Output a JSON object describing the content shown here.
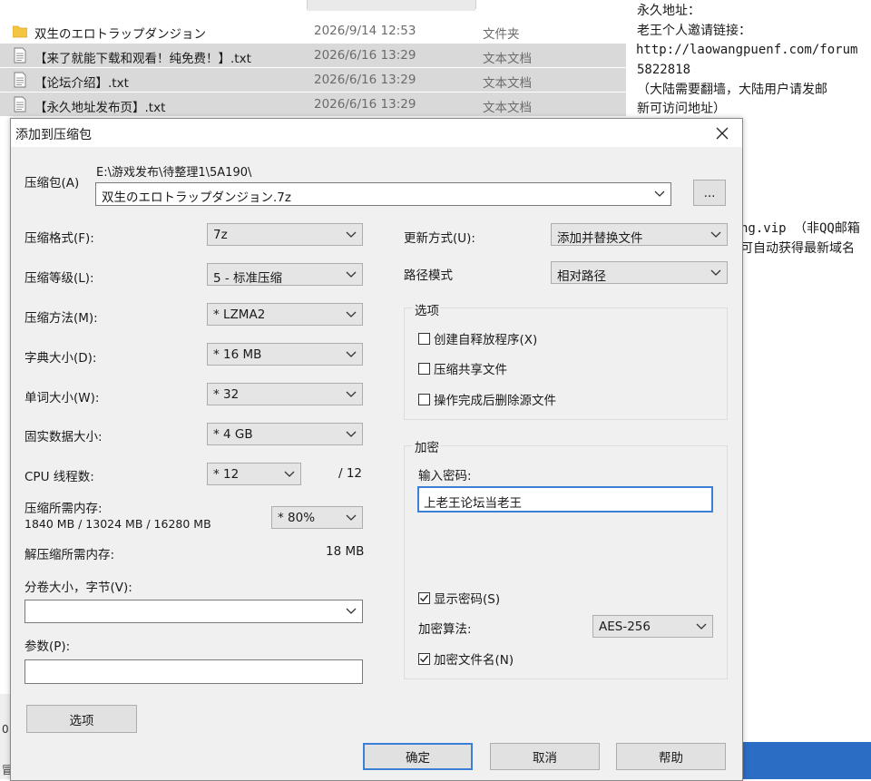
{
  "explorer": {
    "files": [
      {
        "name": "双生のエロトラップダンジョン",
        "date": "2026/9/14 12:53",
        "type": "文件夹",
        "icon": "folder-icon",
        "selected": false
      },
      {
        "name": "【来了就能下载和观看！纯免费！】.txt",
        "date": "2026/6/16 13:29",
        "type": "文本文档",
        "icon": "text-file-icon",
        "selected": true
      },
      {
        "name": "【论坛介绍】.txt",
        "date": "2026/6/16 13:29",
        "type": "文本文档",
        "icon": "text-file-icon",
        "selected": true
      },
      {
        "name": "【永久地址发布页】.txt",
        "date": "2026/6/16 13:29",
        "type": "文本文档",
        "icon": "text-file-icon",
        "selected": true
      }
    ]
  },
  "notepad": {
    "lines": [
      "永久地址：",
      "老王个人邀请链接：",
      "http://laowangpuenf.com/forum",
      "5822818",
      "（大陆需要翻墙，大陆用户请发邮",
      "新可访问地址）",
      "ng.vip （非QQ邮箱",
      "可自动获得最新域名"
    ]
  },
  "left_fragment": [
    "0",
    "",
    "冒"
  ],
  "dialog": {
    "title": "添加到压缩包",
    "archive_label": "压缩包(A)",
    "archive_path": "E:\\游戏发布\\待整理1\\5A190\\",
    "archive_name": "双生のエロトラップダンジョン.7z",
    "browse_label": "...",
    "format_label": "压缩格式(F):",
    "format_value": "7z",
    "level_label": "压缩等级(L):",
    "level_value": "5 - 标准压缩",
    "method_label": "压缩方法(M):",
    "method_value": "* LZMA2",
    "dict_label": "字典大小(D):",
    "dict_value": "* 16 MB",
    "word_label": "单词大小(W):",
    "word_value": "* 32",
    "solid_label": "固实数据大小:",
    "solid_value": "* 4 GB",
    "cpu_label": "CPU 线程数:",
    "cpu_value": "* 12",
    "cpu_total": "/ 12",
    "mem_label": "压缩所需内存:",
    "mem_detail": "1840 MB / 13024 MB / 16280 MB",
    "mem_percent": "* 80%",
    "decomp_label": "解压缩所需内存:",
    "decomp_value": "18 MB",
    "split_label": "分卷大小，字节(V):",
    "split_value": "",
    "params_label": "参数(P):",
    "params_value": "",
    "options_button": "选项",
    "update_label": "更新方式(U):",
    "update_value": "添加并替换文件",
    "path_label": "路径模式",
    "path_value": "相对路径",
    "options_group": "选项",
    "opt_sfx": "创建自释放程序(X)",
    "opt_sfx_checked": false,
    "opt_shared": "压缩共享文件",
    "opt_shared_checked": false,
    "opt_delete": "操作完成后删除源文件",
    "opt_delete_checked": false,
    "encrypt_group": "加密",
    "password_label": "输入密码:",
    "password_value": "上老王论坛当老王",
    "show_password": "显示密码(S)",
    "show_password_checked": true,
    "enc_method_label": "加密算法:",
    "enc_method_value": "AES-256",
    "encrypt_names": "加密文件名(N)",
    "encrypt_names_checked": true,
    "ok_button": "确定",
    "cancel_button": "取消",
    "help_button": "帮助"
  },
  "colors": {
    "dialog_bg": "#f0f0f0",
    "selection": "#d9d9d9",
    "focus_border": "#3c7fd6",
    "taskbar_blue": "#2b6cc4",
    "folder": "#f4c542"
  }
}
